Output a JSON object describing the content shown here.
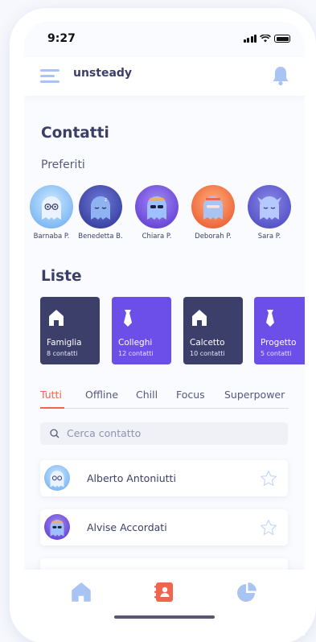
{
  "status": {
    "time": "9:27"
  },
  "app": {
    "title": "unsteady",
    "menu_icon": "hamburger-menu-icon",
    "bell_icon": "bell-icon"
  },
  "page": {
    "title": "Contatti",
    "favorites_title": "Preferiti",
    "lists_title": "Liste"
  },
  "favorites": [
    {
      "name": "Barnaba P.",
      "avatar": "blue-ghost-glasses"
    },
    {
      "name": "Benedetta B.",
      "avatar": "indigo-ghost-sleeping"
    },
    {
      "name": "Chiara P.",
      "avatar": "violet-ghost-sunglasses"
    },
    {
      "name": "Deborah P.",
      "avatar": "orange-ghost-cap"
    },
    {
      "name": "Sara P.",
      "avatar": "purple-ghost-horns"
    }
  ],
  "lists": [
    {
      "label": "Famiglia",
      "count": "8 contatti",
      "icon": "home-icon",
      "color": "#3d3f6b"
    },
    {
      "label": "Colleghi",
      "count": "12 contatti",
      "icon": "tie-icon",
      "color": "#6c4ee8"
    },
    {
      "label": "Calcetto",
      "count": "10 contatti",
      "icon": "home-icon",
      "color": "#3d3f6b"
    },
    {
      "label": "Progetto",
      "count": "5 contatti",
      "icon": "tie-icon",
      "color": "#6c4ee8"
    }
  ],
  "tabs": [
    {
      "label": "Tutti",
      "active": true
    },
    {
      "label": "Offline",
      "active": false
    },
    {
      "label": "Chill",
      "active": false
    },
    {
      "label": "Focus",
      "active": false
    },
    {
      "label": "Superpower",
      "active": false
    }
  ],
  "search": {
    "placeholder": "Cerca contatto"
  },
  "contacts": [
    {
      "name": "Alberto Antoniutti",
      "favorite": false
    },
    {
      "name": "Alvise Accordati",
      "favorite": false
    }
  ],
  "bottom_nav": [
    {
      "icon": "home-icon",
      "active": false
    },
    {
      "icon": "contacts-book-icon",
      "active": true
    },
    {
      "icon": "pie-chart-icon",
      "active": false
    }
  ],
  "colors": {
    "accent": "#f0654e",
    "primary_dark": "#3d3f6b",
    "primary_violet": "#6c4ee8",
    "icon_light": "#a9c4f2"
  }
}
